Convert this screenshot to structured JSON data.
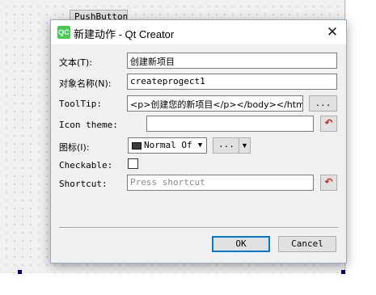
{
  "canvas": {
    "pushbutton_label": "PushButton"
  },
  "dialog": {
    "title": "新建动作 - Qt Creator",
    "logo_text": "QC",
    "close_glyph": "✕",
    "fields": {
      "text": {
        "label": "文本(T):",
        "value": "创建新项目"
      },
      "object_name": {
        "label": "对象名称(N):",
        "value": "createprogect1"
      },
      "tooltip": {
        "label": "ToolTip:",
        "value": "<p>创建您的新项目</p></body></html>",
        "more_button": "..."
      },
      "icon_theme": {
        "label": "Icon theme:",
        "value": ""
      },
      "icon": {
        "label": "图标(I):",
        "combo_value": "Normal Of",
        "dots_button": "..."
      },
      "checkable": {
        "label": "Checkable:",
        "checked": false
      },
      "shortcut": {
        "label": "Shortcut:",
        "placeholder": "Press shortcut"
      }
    },
    "reset_icon_glyph": "↶",
    "buttons": {
      "ok": "OK",
      "cancel": "Cancel"
    }
  },
  "colors": {
    "qt_green": "#41cd52",
    "default_button_border": "#0078d7",
    "reset_icon": "#c8201a",
    "selection_handle": "#00006b"
  },
  "icons": {
    "logo": "qt-creator-logo-icon",
    "close": "close-icon",
    "reset": "reset-arrow-icon",
    "dropdown": "chevron-down-icon"
  }
}
